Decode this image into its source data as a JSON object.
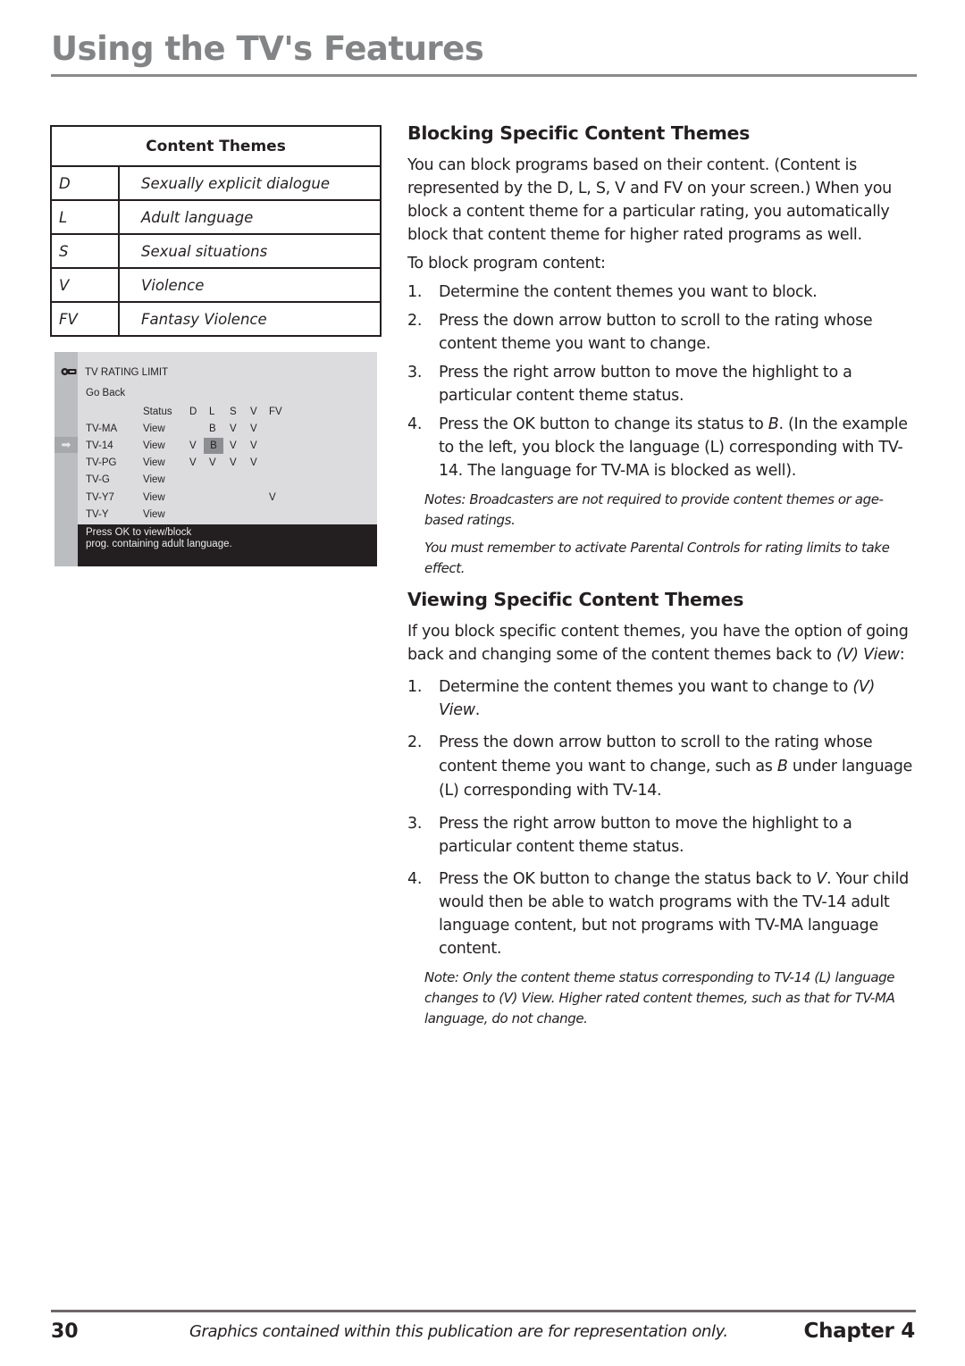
{
  "header": {
    "title": "Using the TV's Features"
  },
  "themes_table": {
    "heading": "Content Themes",
    "rows": [
      {
        "code": "D",
        "description": "Sexually explicit dialogue"
      },
      {
        "code": "L",
        "description": "Adult language"
      },
      {
        "code": "S",
        "description": "Sexual situations"
      },
      {
        "code": "V",
        "description": "Violence"
      },
      {
        "code": "FV",
        "description": "Fantasy Violence"
      }
    ]
  },
  "tv_menu": {
    "title": "TV RATING LIMIT",
    "go_back": "Go Back",
    "columns": {
      "status": "Status",
      "d": "D",
      "l": "L",
      "s": "S",
      "v": "V",
      "fv": "FV"
    },
    "rows": [
      {
        "rating": "TV-MA",
        "status": "View",
        "d": "",
        "l": "B",
        "s": "V",
        "v": "V",
        "fv": ""
      },
      {
        "rating": "TV-14",
        "status": "View",
        "d": "V",
        "l": "B",
        "s": "V",
        "v": "V",
        "fv": ""
      },
      {
        "rating": "TV-PG",
        "status": "View",
        "d": "V",
        "l": "V",
        "s": "V",
        "v": "V",
        "fv": ""
      },
      {
        "rating": "TV-G",
        "status": "View",
        "d": "",
        "l": "",
        "s": "",
        "v": "",
        "fv": ""
      },
      {
        "rating": "TV-Y7",
        "status": "View",
        "d": "",
        "l": "",
        "s": "",
        "v": "",
        "fv": "V"
      },
      {
        "rating": "TV-Y",
        "status": "View",
        "d": "",
        "l": "",
        "s": "",
        "v": "",
        "fv": ""
      }
    ],
    "selected_row": "TV-14",
    "highlighted_cell": "L",
    "message_line1": "Press OK to view/block",
    "message_line2": "prog. containing adult language.",
    "arrow_glyph": "➡"
  },
  "blocking": {
    "heading": "Blocking Specific Content Themes",
    "intro": "You can block programs based on their content. (Content is represented by the D, L, S, V and FV on your screen.) When you block a content theme for a particular rating, you automatically block that content theme for higher rated programs as well.",
    "lead": "To block program content:",
    "steps": [
      {
        "num": "1.",
        "text": "Determine the content themes you want to block."
      },
      {
        "num": "2.",
        "text": "Press the down arrow button to scroll to the rating whose content theme you want to change."
      },
      {
        "num": "3.",
        "text": "Press the right arrow button to move the highlight to a particular content theme status."
      },
      {
        "num": "4.",
        "text_before": "Press the OK button to change its status to ",
        "text_em": "B",
        "text_after": ". (In the example to the left, you block the language (L) corresponding with TV-14. The language for TV-MA is blocked as well)."
      }
    ],
    "note1": "Notes: Broadcasters are not required to provide content themes or age-based ratings.",
    "note2": "You must remember to activate Parental Controls for rating limits to take effect."
  },
  "viewing": {
    "heading": "Viewing Specific Content Themes",
    "intro_before": "If you block specific content themes, you have the option of going back and changing some of the content themes back to ",
    "intro_em": "(V) View",
    "intro_after": ":",
    "steps": [
      {
        "num": "1.",
        "text_before": "Determine the content themes you want to change to ",
        "text_em": "(V) View",
        "text_after": "."
      },
      {
        "num": "2.",
        "text_before": "Press the down arrow button to scroll to the rating whose content theme you want to change, such as ",
        "text_em": "B",
        "text_after": " under language (L) corresponding with TV-14."
      },
      {
        "num": "3.",
        "text": "Press the right arrow button to move the highlight to a particular content theme status."
      },
      {
        "num": "4.",
        "text_before": "Press the OK button to change the status back to ",
        "text_em": "V",
        "text_after": ".  Your child would then be able to watch programs with the TV-14 adult language content, but not programs with TV-MA language content."
      }
    ],
    "note": "Note:  Only the content theme status corresponding to TV-14  (L) language changes to (V) View. Higher rated content themes, such as that for TV-MA language, do not change."
  },
  "footer": {
    "page_number": "30",
    "disclaimer": "Graphics contained within this publication are for representation only.",
    "chapter": "Chapter 4"
  }
}
